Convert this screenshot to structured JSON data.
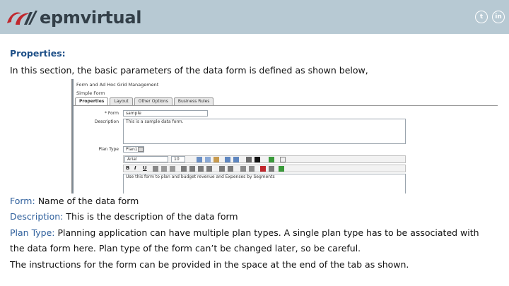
{
  "brand": {
    "logo_text": "epmvirtual",
    "colors": {
      "header_bg": "#b7c9d3",
      "logo_red": "#c0272d",
      "logo_dark": "#333f48",
      "heading_blue": "#1d4f87",
      "label_blue": "#2e5f9c"
    }
  },
  "social": {
    "twitter_icon": "twitter-icon",
    "twitter_glyph": "t",
    "linkedin_icon": "linkedin-icon",
    "linkedin_glyph": "in"
  },
  "content": {
    "heading": "Properties:",
    "intro": "In this section, the basic parameters of the data form is defined as shown below,",
    "form_label": "Form:",
    "form_text": "Name of the data form",
    "description_label": "Description:",
    "description_text": "This is the description of the data form",
    "plan_type_label": "Plan Type:",
    "plan_type_text_1": "Planning application can have multiple plan types. A single plan type  has to be associated with",
    "plan_type_text_2": "the data form here. Plan type of the form can’t be changed later, so be careful.",
    "instructions_text": "The instructions for the form can be provided in the space at the end of the tab as shown."
  },
  "screenshot": {
    "title": "Form and Ad Hoc Grid Management",
    "subtitle": "Simple Form",
    "tabs": [
      "Properties",
      "Layout",
      "Other Options",
      "Business Rules"
    ],
    "active_tab": "Properties",
    "form_field_label": "* Form",
    "form_field_value": "sample",
    "description_field_label": "Description",
    "description_field_value": "This is a sample data form.",
    "plan_type_label": "Plan Type",
    "plan_type_value": "Plan1",
    "font_value": "Arial",
    "size_value": "10",
    "bold_glyph": "B",
    "italic_glyph": "I",
    "underline_glyph": "U",
    "instructions_value": "Use this form to plan and budget revenue and Expenses by Segments"
  }
}
